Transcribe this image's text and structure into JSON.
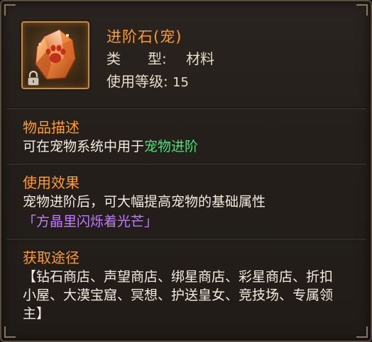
{
  "item": {
    "name": "进阶石(宠)",
    "type_label_a": "类",
    "type_label_b": "型:",
    "type_value": "材料",
    "level_label": "使用等级:",
    "level_value": "15",
    "icon": "paw-crystal-icon",
    "locked_icon": "lock-icon"
  },
  "description": {
    "title": "物品描述",
    "text_prefix": "可在宠物系统中用于",
    "text_highlight": "宠物进阶"
  },
  "effect": {
    "title": "使用效果",
    "text": "宠物进阶后，可大幅提高宠物的基础属性",
    "flavor": "「方晶里闪烁着光芒」"
  },
  "acquire": {
    "title": "获取途径",
    "text": "【钻石商店、声望商店、绑星商店、彩星商店、折扣小屋、大漠宝窟、冥想、护送皇女、竞技场、专属领主】"
  },
  "colors": {
    "title_orange": "#ff9a2e",
    "highlight_green": "#4fe07a",
    "flavor_purple": "#c27bff",
    "body_text": "#f1ebe0"
  }
}
